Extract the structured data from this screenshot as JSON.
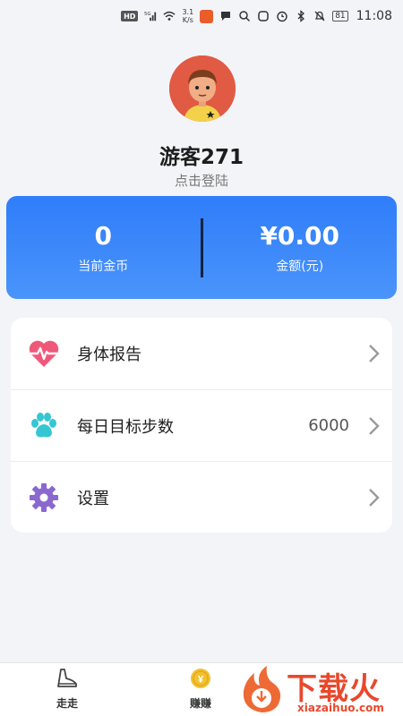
{
  "status_bar": {
    "hd_label": "HD",
    "network_label": "5G",
    "speed_value": "3.1",
    "speed_unit": "K/s",
    "battery": "81",
    "time": "11:08"
  },
  "profile": {
    "nickname": "游客271",
    "login_hint": "点击登陆"
  },
  "stats": {
    "coins_value": "0",
    "coins_label": "当前金币",
    "amount_value": "¥0.00",
    "amount_label": "金额(元)"
  },
  "menu": {
    "items": [
      {
        "label": "身体报告",
        "value": "",
        "icon": "heartbeat-icon",
        "color": "#f0587a"
      },
      {
        "label": "每日目标步数",
        "value": "6000",
        "icon": "paw-icon",
        "color": "#36c6d3"
      },
      {
        "label": "设置",
        "value": "",
        "icon": "gear-icon",
        "color": "#8b67d0"
      }
    ]
  },
  "bottom_nav": {
    "walk_label": "走走",
    "earn_label": "赚赚"
  },
  "watermark": {
    "text": "下载火",
    "url": "xiazaihuo.com"
  },
  "colors": {
    "accent": "#2f7dfa",
    "background": "#f3f4f7"
  }
}
